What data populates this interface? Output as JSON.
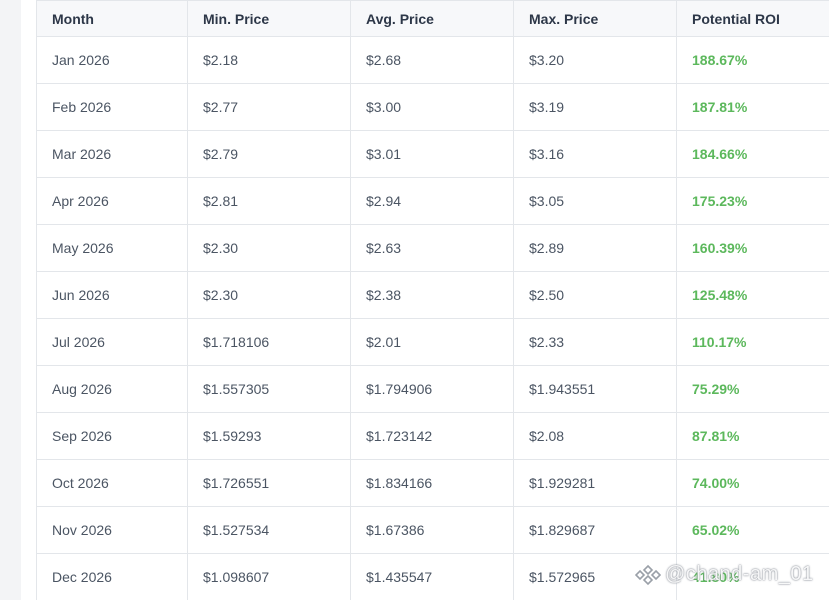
{
  "table": {
    "headers": {
      "month": "Month",
      "min": "Min. Price",
      "avg": "Avg. Price",
      "max": "Max. Price",
      "roi": "Potential ROI"
    },
    "rows": [
      {
        "month": "Jan 2026",
        "min": "$2.18",
        "avg": "$2.68",
        "max": "$3.20",
        "roi": "188.67%"
      },
      {
        "month": "Feb 2026",
        "min": "$2.77",
        "avg": "$3.00",
        "max": "$3.19",
        "roi": "187.81%"
      },
      {
        "month": "Mar 2026",
        "min": "$2.79",
        "avg": "$3.01",
        "max": "$3.16",
        "roi": "184.66%"
      },
      {
        "month": "Apr 2026",
        "min": "$2.81",
        "avg": "$2.94",
        "max": "$3.05",
        "roi": "175.23%"
      },
      {
        "month": "May 2026",
        "min": "$2.30",
        "avg": "$2.63",
        "max": "$2.89",
        "roi": "160.39%"
      },
      {
        "month": "Jun 2026",
        "min": "$2.30",
        "avg": "$2.38",
        "max": "$2.50",
        "roi": "125.48%"
      },
      {
        "month": "Jul 2026",
        "min": "$1.718106",
        "avg": "$2.01",
        "max": "$2.33",
        "roi": "110.17%"
      },
      {
        "month": "Aug 2026",
        "min": "$1.557305",
        "avg": "$1.794906",
        "max": "$1.943551",
        "roi": "75.29%"
      },
      {
        "month": "Sep 2026",
        "min": "$1.59293",
        "avg": "$1.723142",
        "max": "$2.08",
        "roi": "87.81%"
      },
      {
        "month": "Oct 2026",
        "min": "$1.726551",
        "avg": "$1.834166",
        "max": "$1.929281",
        "roi": "74.00%"
      },
      {
        "month": "Nov 2026",
        "min": "$1.527534",
        "avg": "$1.67386",
        "max": "$1.829687",
        "roi": "65.02%"
      },
      {
        "month": "Dec 2026",
        "min": "$1.098607",
        "avg": "$1.435547",
        "max": "$1.572965",
        "roi": "41.80%"
      }
    ]
  },
  "watermark": {
    "text": "@chand-am_01",
    "icon": "binance-logo-icon"
  },
  "colors": {
    "roi_positive": "#5cb85c",
    "header_bg": "#f7f8fa",
    "border": "#e3e6ea"
  }
}
